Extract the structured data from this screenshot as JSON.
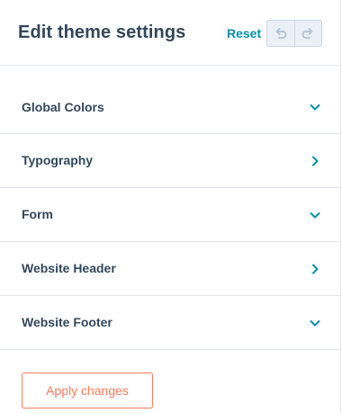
{
  "header": {
    "title": "Edit theme settings",
    "reset_label": "Reset",
    "undo_icon": "undo-icon",
    "redo_icon": "redo-icon"
  },
  "sections": [
    {
      "label": "Global Colors",
      "icon": "chevron-down-icon",
      "state": "collapsed-down"
    },
    {
      "label": "Typography",
      "icon": "chevron-right-icon",
      "state": "navigate"
    },
    {
      "label": "Form",
      "icon": "chevron-down-icon",
      "state": "collapsed-down"
    },
    {
      "label": "Website Header",
      "icon": "chevron-right-icon",
      "state": "navigate"
    },
    {
      "label": "Website Footer",
      "icon": "chevron-down-icon",
      "state": "collapsed-down"
    }
  ],
  "footer": {
    "apply_label": "Apply changes"
  },
  "colors": {
    "text": "#33475b",
    "link": "#0091ae",
    "accent": "#ff7a59",
    "border": "#dfe3eb",
    "disabled_bg": "#eaf0f6"
  }
}
